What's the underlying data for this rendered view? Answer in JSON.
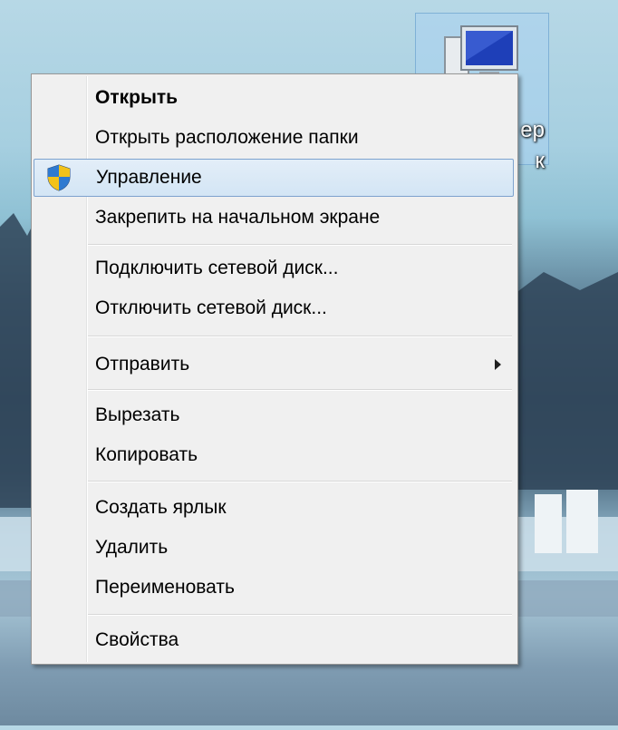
{
  "desktop": {
    "icon_label": "ер\nк",
    "icon_name": "computer-icon"
  },
  "context_menu": {
    "groups": [
      [
        {
          "label": "Открыть",
          "bold": true
        },
        {
          "label": "Открыть расположение папки"
        },
        {
          "label": "Управление",
          "icon": "uac-shield-icon",
          "highlighted": true
        },
        {
          "label": "Закрепить на начальном экране"
        }
      ],
      [
        {
          "label": "Подключить сетевой диск..."
        },
        {
          "label": "Отключить сетевой диск..."
        }
      ],
      [
        {
          "label": "Отправить",
          "submenu": true
        }
      ],
      [
        {
          "label": "Вырезать"
        },
        {
          "label": "Копировать"
        }
      ],
      [
        {
          "label": "Создать ярлык"
        },
        {
          "label": "Удалить"
        },
        {
          "label": "Переименовать"
        }
      ],
      [
        {
          "label": "Свойства"
        }
      ]
    ]
  },
  "colors": {
    "menu_background": "#f0f0f0",
    "highlight_background": "#d9e8f6",
    "highlight_border": "#7da2ce"
  }
}
